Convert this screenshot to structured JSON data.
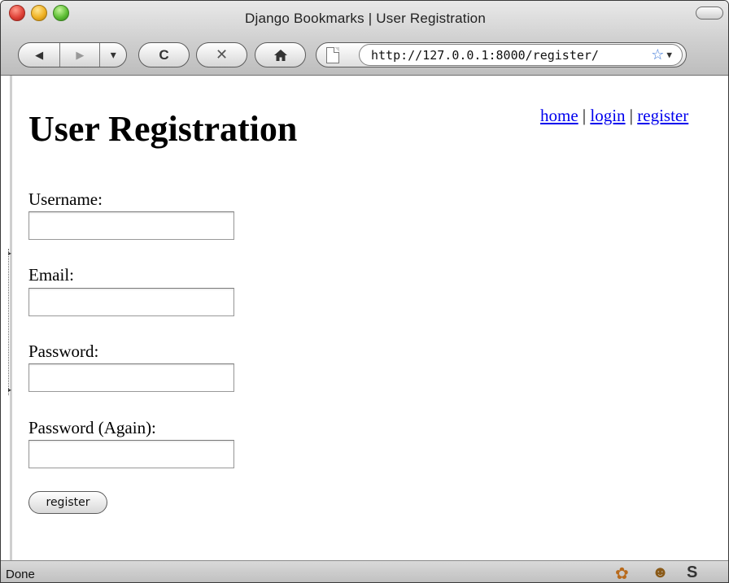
{
  "window": {
    "title": "Django Bookmarks | User Registration"
  },
  "toolbar": {
    "back_icon": "◀",
    "forward_icon": "▶",
    "history_icon": "▾",
    "reload_icon": "C",
    "stop_icon": "✕",
    "home_icon": "⌂",
    "url": "http://127.0.0.1:8000/register/",
    "bookmark_icon": "☆",
    "url_dropdown_icon": "▼"
  },
  "page": {
    "heading": "User Registration",
    "nav": {
      "home": "home",
      "separator": "|",
      "login": "login",
      "register": "register"
    },
    "form": {
      "fields": [
        {
          "label": "Username:",
          "value": ""
        },
        {
          "label": "Email:",
          "value": ""
        },
        {
          "label": "Password:",
          "value": ""
        },
        {
          "label": "Password (Again):",
          "value": ""
        }
      ],
      "submit_label": "register"
    }
  },
  "statusbar": {
    "text": "Done",
    "icons": [
      "firebug-icon",
      "greasemonkey-icon",
      "s-icon"
    ]
  }
}
